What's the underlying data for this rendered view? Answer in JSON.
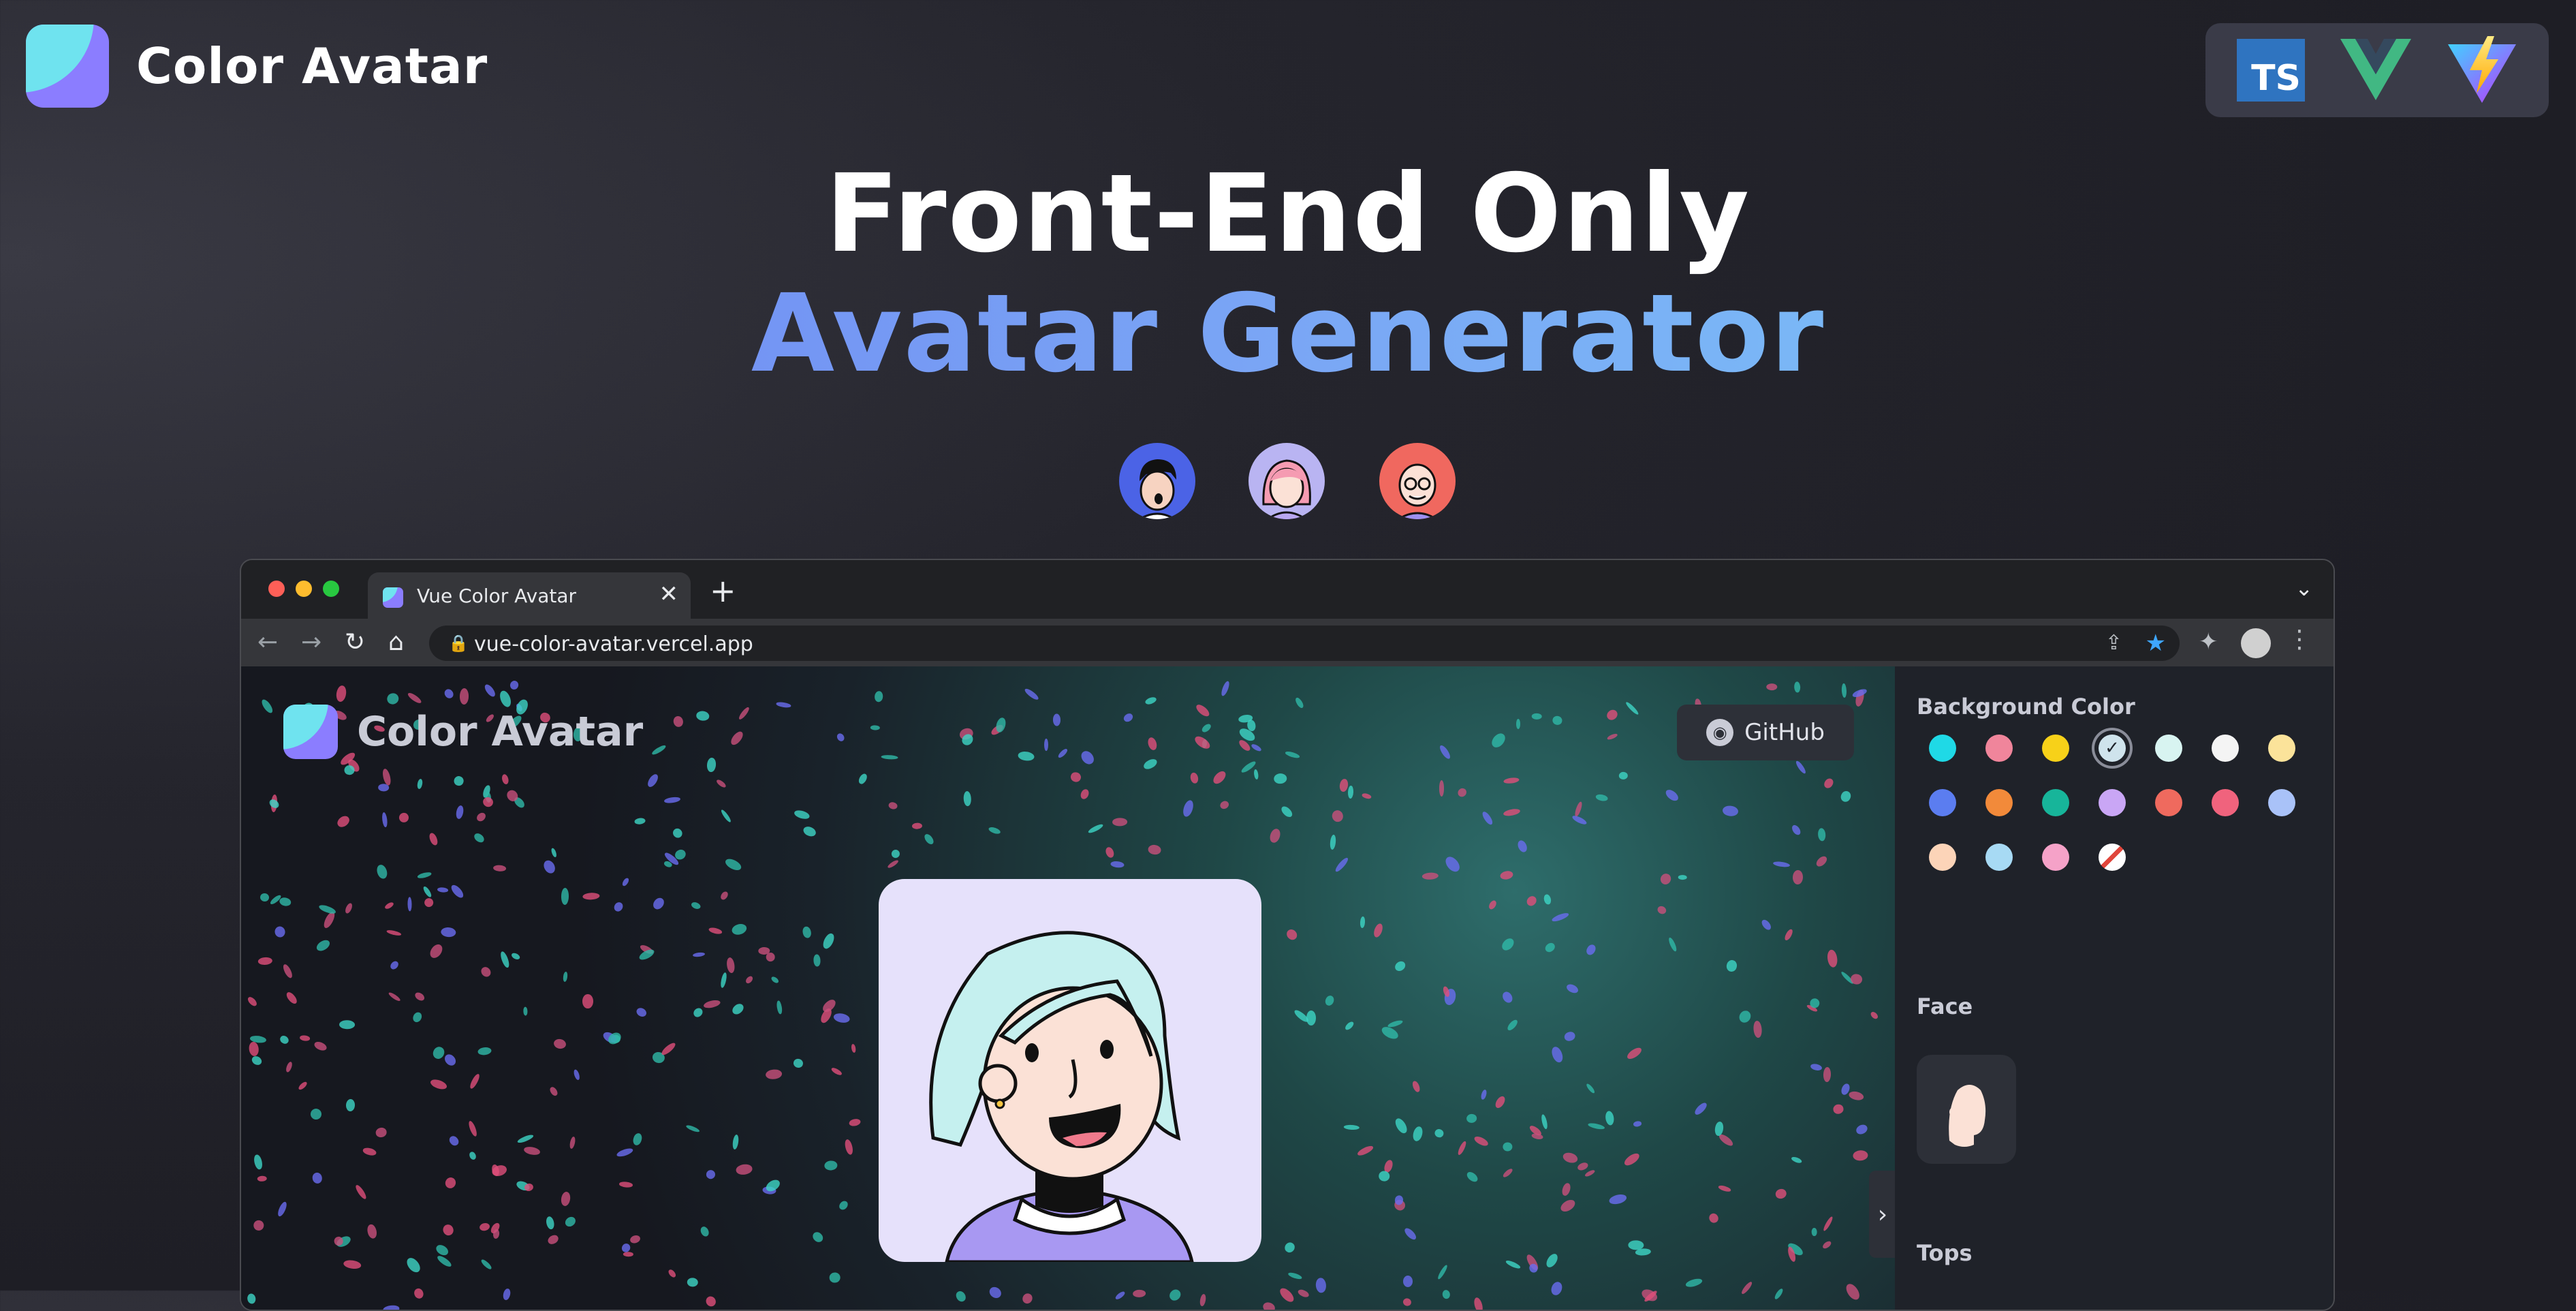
{
  "brand": {
    "title": "Color Avatar"
  },
  "tech_badges": [
    "typescript-icon",
    "vue-icon",
    "vite-icon"
  ],
  "tech": {
    "ts_label": "TS"
  },
  "headline": {
    "line1": "Front-End Only",
    "line2": "Avatar Generator"
  },
  "samples": [
    {
      "name": "sample-avatar-1",
      "bg": "#4b63e6"
    },
    {
      "name": "sample-avatar-2",
      "bg": "#b9b4f2"
    },
    {
      "name": "sample-avatar-3",
      "bg": "#f0685f"
    }
  ],
  "browser": {
    "tab_title": "Vue Color Avatar",
    "tab_close": "✕",
    "new_tab": "+",
    "tab_menu": "⌄",
    "url": "vue-color-avatar.vercel.app",
    "nav": {
      "back": "←",
      "forward": "→",
      "reload": "↻",
      "home": "⌂"
    },
    "lock": "🔒",
    "share": "⇪",
    "star": "★",
    "extensions": "✦",
    "menu": "⋮"
  },
  "app": {
    "title": "Color Avatar",
    "github_label": "GitHub",
    "github_icon": "◉",
    "collapse": "›"
  },
  "sidebar": {
    "background_color_label": "Background Color",
    "face_label": "Face",
    "tops_label": "Tops",
    "colors": [
      "#1fd9e6",
      "#f0859b",
      "#f7d119",
      "#cfe3ec",
      "#d8f4f1",
      "#f4f4f4",
      "#fbe39a",
      "#5b7df0",
      "#f28a3a",
      "#17b59a",
      "#c9a6f5",
      "#ef6a5e",
      "#f0637d",
      "#a9c2f8",
      "#fcd4b8",
      "#a7daf4",
      "#f5a2c8",
      "#ffffff"
    ],
    "selected_index": 3
  },
  "colors": {
    "accent": "#8b7dff",
    "cyan": "#6fe3ef",
    "bg": "#1e1e25"
  }
}
